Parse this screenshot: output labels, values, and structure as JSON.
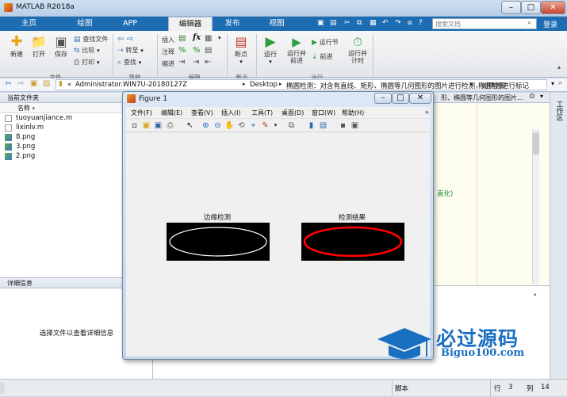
{
  "app": {
    "title": "MATLAB R2018a"
  },
  "tabs": [
    "主页",
    "绘图",
    "APP",
    "编辑器",
    "发布",
    "视图"
  ],
  "search": {
    "placeholder": "搜索文档",
    "login": "登录"
  },
  "ribbon": {
    "file": {
      "new": "新建",
      "open": "打开",
      "save": "保存",
      "find_files": "查找文件",
      "compare": "比较",
      "print": "打印",
      "group": "文件"
    },
    "navigate": {
      "goto": "转至",
      "find": "查找",
      "group": "导航"
    },
    "edit": {
      "insert": "插入",
      "comment": "注释",
      "indent": "缩进",
      "fx": "fx",
      "group": "编辑"
    },
    "breakpoints": {
      "label": "断点",
      "group": "断点"
    },
    "run": {
      "run": "运行",
      "run_advance": "运行并\n前进",
      "run_section": "运行节",
      "advance": "前进",
      "run_time": "运行并\n计时",
      "group": "运行"
    }
  },
  "address": {
    "prefix": "«",
    "segments": [
      "Administrator.WIN7U-20180127Z",
      "Desktop",
      "椭圆检测：对含有直线、矩形、椭圆等几何图形的图片进行检测，对椭圆进行标记",
      "椭圆检测"
    ]
  },
  "current_folder": {
    "header": "当前文件夹",
    "column": "名称",
    "files": [
      {
        "name": "tuoyuanjiance.m",
        "icon": "m-file-icon"
      },
      {
        "name": "lixinlv.m",
        "icon": "m-file-icon"
      },
      {
        "name": "8.png",
        "icon": "image-file-icon"
      },
      {
        "name": "3.png",
        "icon": "image-file-icon"
      },
      {
        "name": "2.png",
        "icon": "image-file-icon"
      }
    ]
  },
  "details": {
    "header": "详细信息",
    "placeholder": "选择文件以查看详细信息"
  },
  "editor_bg": {
    "tab_text": "形、椭圆等几何图形的图片…",
    "code_fragment": "直化)"
  },
  "workspace": {
    "label": "工作区"
  },
  "figure": {
    "title": "Figure 1",
    "menu": [
      "文件(F)",
      "编辑(E)",
      "查看(V)",
      "插入(I)",
      "工具(T)",
      "桌面(D)",
      "窗口(W)",
      "帮助(H)"
    ],
    "axes": [
      {
        "title": "边缘检测",
        "ellipse_color": "#ffffff"
      },
      {
        "title": "检测结果",
        "ellipse_color": "#ff0000"
      }
    ]
  },
  "status": {
    "script": "脚本",
    "row_label": "行",
    "row": "3",
    "col_label": "列",
    "col": "14"
  },
  "watermark": {
    "brand": "必过源码",
    "url": "Biguo100.com"
  },
  "colors": {
    "ribbon_blue": "#1e6db3",
    "run_green": "#2e9e3e",
    "watermark_blue": "#1a6fc1"
  }
}
